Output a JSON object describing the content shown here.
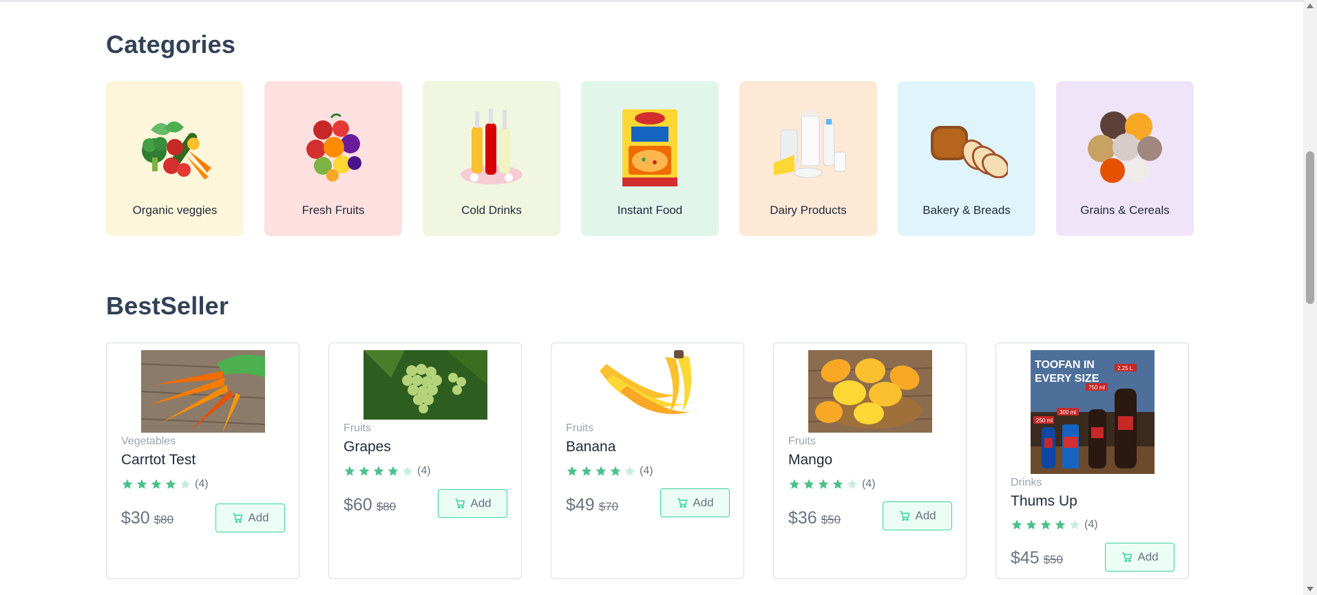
{
  "sections": {
    "categories_title": "Categories",
    "bestseller_title": "BestSeller"
  },
  "categories": [
    {
      "label": "Organic veggies",
      "bg": "#fef6da",
      "icon": "vegetables-image"
    },
    {
      "label": "Fresh Fruits",
      "bg": "#fee0e0",
      "icon": "fruits-image"
    },
    {
      "label": "Cold Drinks",
      "bg": "#f0f6e0",
      "icon": "cold-drinks-image"
    },
    {
      "label": "Instant Food",
      "bg": "#e1f5eb",
      "icon": "instant-food-image"
    },
    {
      "label": "Dairy Products",
      "bg": "#fee9d6",
      "icon": "dairy-image"
    },
    {
      "label": "Bakery & Breads",
      "bg": "#e0f4fb",
      "icon": "bakery-image"
    },
    {
      "label": "Grains & Cereals",
      "bg": "#f0e4f9",
      "icon": "grains-image"
    }
  ],
  "products": [
    {
      "category": "Vegetables",
      "name": "Carrtot Test",
      "rating": 4,
      "count": "(4)",
      "price": "$30",
      "old_price": "$80",
      "add_label": "Add"
    },
    {
      "category": "Fruits",
      "name": "Grapes",
      "rating": 4,
      "count": "(4)",
      "price": "$60",
      "old_price": "$80",
      "add_label": "Add"
    },
    {
      "category": "Fruits",
      "name": "Banana",
      "rating": 4,
      "count": "(4)",
      "price": "$49",
      "old_price": "$70",
      "add_label": "Add"
    },
    {
      "category": "Fruits",
      "name": "Mango",
      "rating": 4,
      "count": "(4)",
      "price": "$36",
      "old_price": "$50",
      "add_label": "Add"
    },
    {
      "category": "Drinks",
      "name": "Thums Up",
      "rating": 4,
      "count": "(4)",
      "price": "$45",
      "old_price": "$50",
      "add_label": "Add",
      "image_text": [
        "TOOFAN IN",
        "EVERY SIZE",
        "250 ml",
        "300 ml",
        "750 ml",
        "2.25 L"
      ]
    }
  ],
  "colors": {
    "star_filled": "#4fbf8b",
    "star_empty": "#c8ece0",
    "accent": "#34d399"
  }
}
